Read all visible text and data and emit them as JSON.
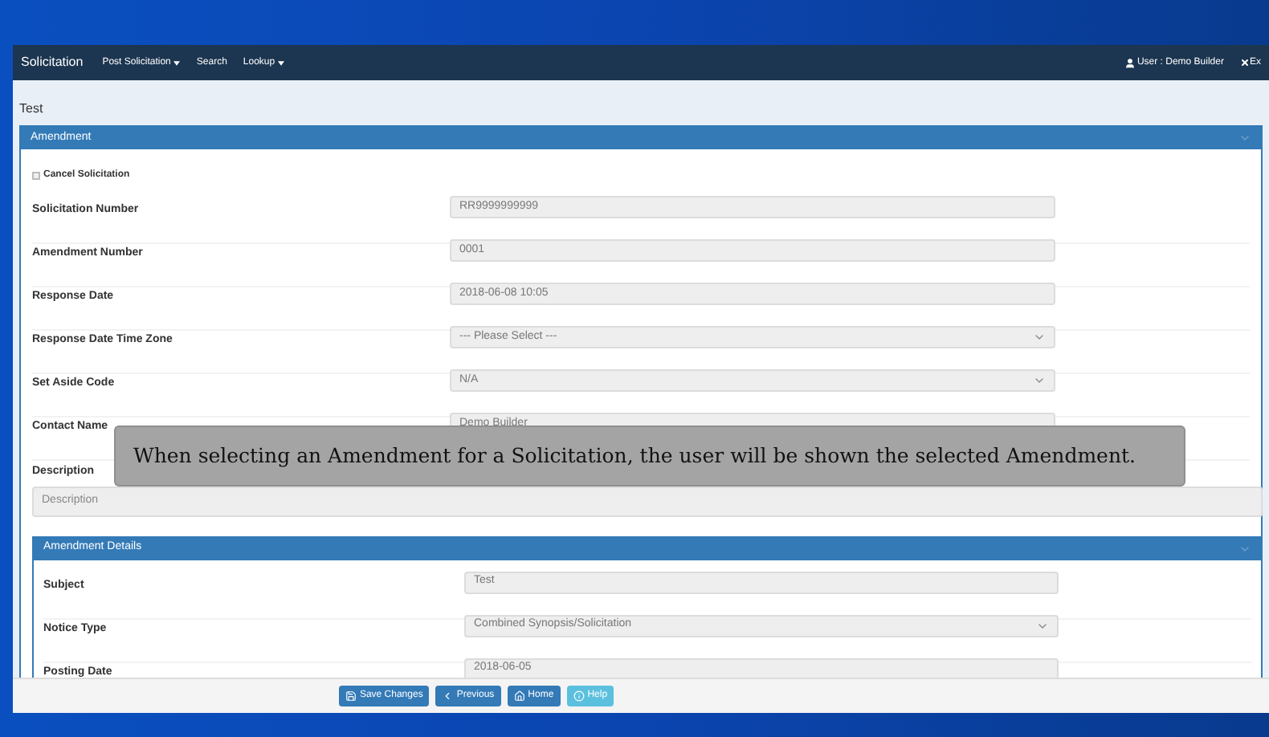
{
  "navbar": {
    "brand": "Solicitation",
    "menu": [
      {
        "label": "Post Solicitation",
        "dropdown": true
      },
      {
        "label": "Search",
        "dropdown": false
      },
      {
        "label": "Lookup",
        "dropdown": true
      }
    ],
    "user": "User : Demo Builder",
    "exit": "Ex"
  },
  "page_title": "Test",
  "amendment_panel": {
    "title": "Amendment",
    "expanded": true,
    "cancel_checkbox": {
      "label": "Cancel Solicitation",
      "checked": false
    },
    "fields": [
      {
        "kind": "input",
        "label": "Solicitation Number",
        "value": "RR9999999999"
      },
      {
        "kind": "input",
        "label": "Amendment Number",
        "value": "0001"
      },
      {
        "kind": "input",
        "label": "Response Date",
        "value": "2018-06-08 10:05"
      },
      {
        "kind": "select",
        "label": "Response Date Time Zone",
        "value": "--- Please Select ---"
      },
      {
        "kind": "select",
        "label": "Set Aside Code",
        "value": "N/A"
      },
      {
        "kind": "input",
        "label": "Contact Name",
        "value": "Demo Builder"
      }
    ],
    "description": {
      "label": "Description",
      "placeholder": "Description"
    }
  },
  "details_panel": {
    "title": "Amendment Details",
    "expanded": true,
    "fields": [
      {
        "kind": "input",
        "label": "Subject",
        "value": "Test"
      },
      {
        "kind": "select",
        "label": "Notice Type",
        "value": "Combined Synopsis/Solicitation"
      },
      {
        "kind": "input",
        "label": "Posting Date",
        "value": "2018-06-05"
      }
    ]
  },
  "footer_buttons": [
    {
      "kind": "save",
      "label": "Save Changes"
    },
    {
      "kind": "previous",
      "label": "Previous"
    },
    {
      "kind": "home",
      "label": "Home"
    },
    {
      "kind": "help",
      "label": "Help"
    }
  ],
  "caption": "When selecting an Amendment for a Solicitation, the user will be shown the selected Amendment."
}
